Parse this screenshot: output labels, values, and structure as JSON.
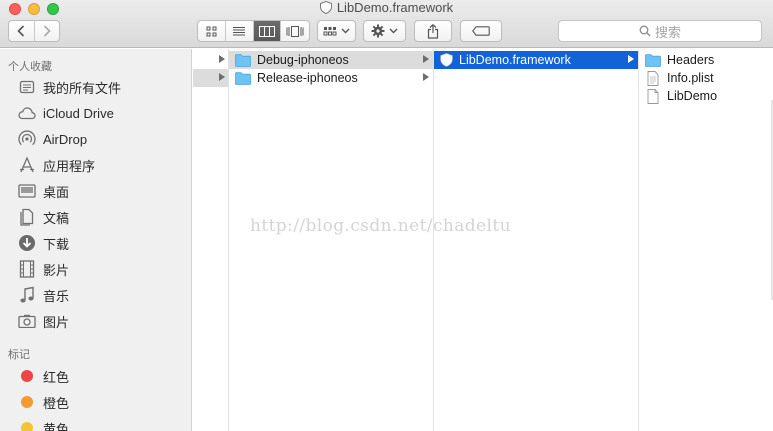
{
  "window": {
    "title": "LibDemo.framework"
  },
  "toolbar": {
    "search_placeholder": "搜索"
  },
  "sidebar": {
    "favorites_heading": "个人收藏",
    "favorites": [
      {
        "label": "我的所有文件",
        "icon": "all-files-icon"
      },
      {
        "label": "iCloud Drive",
        "icon": "cloud-icon"
      },
      {
        "label": "AirDrop",
        "icon": "airdrop-icon"
      },
      {
        "label": "应用程序",
        "icon": "applications-icon"
      },
      {
        "label": "桌面",
        "icon": "desktop-icon"
      },
      {
        "label": "文稿",
        "icon": "documents-icon"
      },
      {
        "label": "下载",
        "icon": "downloads-icon"
      },
      {
        "label": "影片",
        "icon": "movies-icon"
      },
      {
        "label": "音乐",
        "icon": "music-icon"
      },
      {
        "label": "图片",
        "icon": "pictures-icon"
      }
    ],
    "tags_heading": "标记",
    "tags": [
      {
        "label": "红色",
        "color": "#ee4444"
      },
      {
        "label": "橙色",
        "color": "#f39a33"
      },
      {
        "label": "黄色",
        "color": "#f0c53a"
      }
    ]
  },
  "columns": {
    "col1": [
      {
        "name": "Debug-iphoneos",
        "type": "folder"
      },
      {
        "name": "Release-iphoneos",
        "type": "folder"
      }
    ],
    "col2": [
      {
        "name": "LibDemo.framework",
        "type": "framework"
      }
    ],
    "col3": [
      {
        "name": "Headers",
        "type": "folder"
      },
      {
        "name": "Info.plist",
        "type": "plist"
      },
      {
        "name": "LibDemo",
        "type": "file"
      }
    ]
  },
  "watermark": "http://blog.csdn.net/chadeltu",
  "colors": {
    "selection": "#1163d7",
    "folder": "#6fc2f4"
  }
}
